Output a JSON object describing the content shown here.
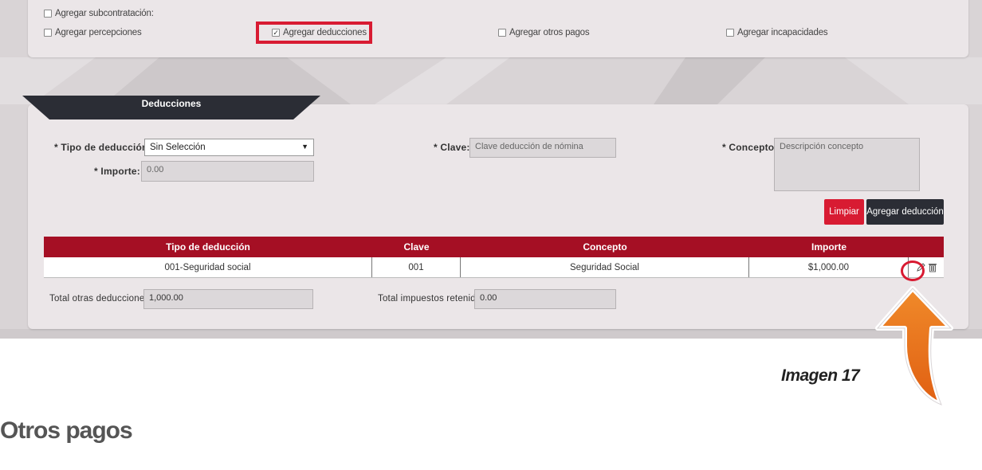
{
  "options": {
    "subcontratacion": "Agregar subcontratación:",
    "percepciones": "Agregar percepciones",
    "deducciones": "Agregar deducciones",
    "otros_pagos": "Agregar otros pagos",
    "incapacidades": "Agregar incapacidades"
  },
  "section_tab": "Deducciones",
  "form": {
    "tipo_label": "* Tipo de deducción:",
    "tipo_value": "Sin Selección",
    "clave_label": "* Clave:",
    "clave_placeholder": "Clave deducción de nómina",
    "concepto_label": "* Concepto:",
    "concepto_placeholder": "Descripción concepto",
    "importe_label": "* Importe:",
    "importe_value": "0.00"
  },
  "buttons": {
    "limpiar": "Limpiar",
    "agregar": "Agregar deducción"
  },
  "table": {
    "headers": [
      "Tipo de deducción",
      "Clave",
      "Concepto",
      "Importe"
    ],
    "rows": [
      [
        "001-Seguridad social",
        "001",
        "Seguridad Social",
        "$1,000.00"
      ]
    ]
  },
  "totals": {
    "otras_label": "Total otras deducciones:",
    "otras_value": "1,000.00",
    "impuestos_label": "Total impuestos retenidos:",
    "impuestos_value": "0.00"
  },
  "caption": "Imagen 17",
  "heading": "Otros pagos",
  "colors": {
    "accent_red": "#d81b32",
    "header_red": "#a50f24",
    "dark": "#2b2d35",
    "arrow_orange": "#e8741e"
  }
}
